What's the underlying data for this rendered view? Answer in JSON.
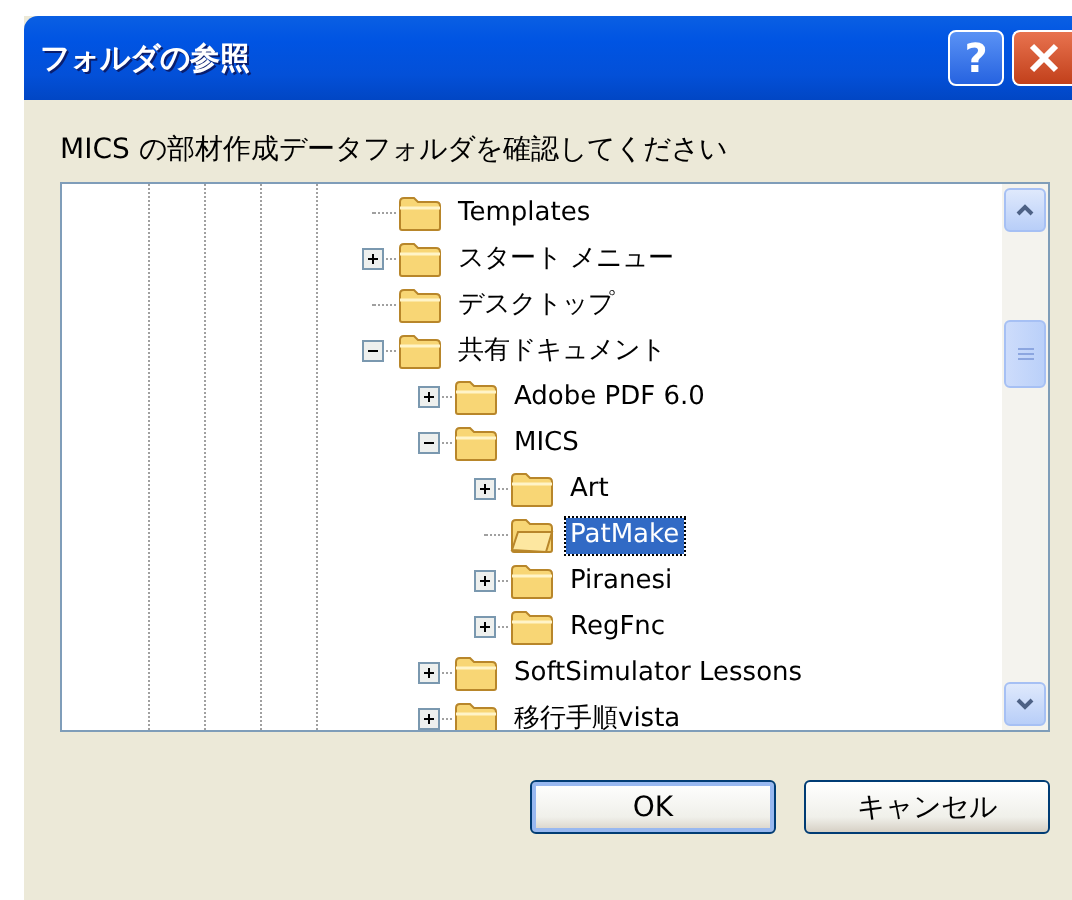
{
  "window": {
    "title": "フォルダの参照",
    "help_button": "?"
  },
  "prompt": "MICS の部材作成データフォルダを確認してください",
  "tree": {
    "items": [
      {
        "label": "Templates",
        "selected": false
      },
      {
        "label": "スタート メニュー",
        "selected": false,
        "expanded": false
      },
      {
        "label": "デスクトップ",
        "selected": false
      },
      {
        "label": "共有ドキュメント",
        "selected": false,
        "expanded": true,
        "children": [
          {
            "label": "Adobe PDF 6.0",
            "selected": false,
            "expanded": false
          },
          {
            "label": "MICS",
            "selected": false,
            "expanded": true,
            "children": [
              {
                "label": "Art",
                "selected": false,
                "expanded": false
              },
              {
                "label": "PatMake",
                "selected": true
              },
              {
                "label": "Piranesi",
                "selected": false,
                "expanded": false
              },
              {
                "label": "RegFnc",
                "selected": false,
                "expanded": false
              }
            ]
          },
          {
            "label": "SoftSimulator Lessons",
            "selected": false,
            "expanded": false
          },
          {
            "label": "移行手順vista",
            "selected": false,
            "expanded": false
          }
        ]
      }
    ]
  },
  "buttons": [
    "OK",
    "キャンセル"
  ]
}
